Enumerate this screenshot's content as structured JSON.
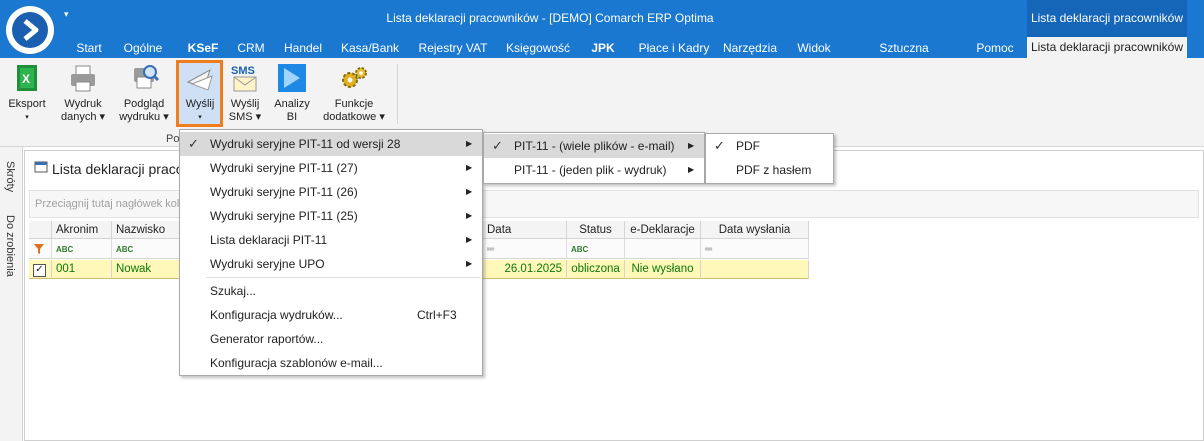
{
  "window": {
    "title": "Lista deklaracji pracowników - [DEMO] Comarch ERP Optima",
    "context_header": "Lista deklaracji pracowników",
    "qat_glyph": "▾"
  },
  "tabs": [
    {
      "label": "Start"
    },
    {
      "label": "Ogólne"
    },
    {
      "label": "KSeF"
    },
    {
      "label": "CRM"
    },
    {
      "label": "Handel"
    },
    {
      "label": "Kasa/Bank"
    },
    {
      "label": "Rejestry VAT"
    },
    {
      "label": "Księgowość"
    },
    {
      "label": "JPK"
    },
    {
      "label": "Płace i Kadry"
    },
    {
      "label": "Narzędzia"
    },
    {
      "label": "Widok"
    },
    {
      "label": "Sztuczna inteligencja"
    },
    {
      "label": "Pomoc"
    },
    {
      "label": "Lista deklaracji pracowników"
    }
  ],
  "ribbon": {
    "buttons": [
      {
        "line1": "Eksport",
        "line2": "▾",
        "icon": "excel-icon"
      },
      {
        "line1": "Wydruk",
        "line2": "danych ▾",
        "icon": "printer-icon"
      },
      {
        "line1": "Podgląd",
        "line2": "wydruku ▾",
        "icon": "print-preview-icon"
      },
      {
        "line1": "Wyślij",
        "line2": "▾",
        "icon": "send-icon"
      },
      {
        "line1": "Wyślij",
        "line2": "SMS ▾",
        "icon": "sms-icon"
      },
      {
        "line1": "Analizy",
        "line2": "BI",
        "icon": "bi-icon"
      },
      {
        "line1": "Funkcje",
        "line2": "dodatkowe ▾",
        "icon": "gears-icon"
      }
    ],
    "group_label": "Po"
  },
  "side_panel": {
    "shortcuts": "Skróty",
    "todo": "Do zrobienia"
  },
  "list": {
    "title": "Lista deklaracji praco",
    "group_placeholder": "Przeciągnij tutaj nagłówek kolu",
    "columns": [
      "Akronim ▲",
      "Nazwisko",
      "Data obliczenia",
      "Status",
      "e-Deklaracje",
      "Data wysłania"
    ],
    "filter_abc": "ABC",
    "filter_eq": "═",
    "rows": [
      {
        "checked": "✓",
        "akronim": "001",
        "nazwisko": "Nowak",
        "data_obliczenia": "26.01.2025",
        "status": "obliczona",
        "e_deklaracje": "Nie wysłano",
        "data_wyslania": ""
      }
    ]
  },
  "menu": {
    "items": [
      {
        "label": "Wydruki seryjne PIT-11 od wersji 28",
        "check": "✓",
        "arrow": "▶"
      },
      {
        "label": "Wydruki seryjne PIT-11 (27)",
        "arrow": "▶"
      },
      {
        "label": "Wydruki seryjne PIT-11 (26)",
        "arrow": "▶"
      },
      {
        "label": "Wydruki seryjne PIT-11 (25)",
        "arrow": "▶"
      },
      {
        "label": "Lista deklaracji PIT-11",
        "arrow": "▶"
      },
      {
        "label": "Wydruki seryjne UPO",
        "arrow": "▶"
      },
      {
        "label": "Szukaj..."
      },
      {
        "label": "Konfiguracja wydruków...",
        "shortcut": "Ctrl+F3"
      },
      {
        "label": "Generator raportów..."
      },
      {
        "label": "Konfiguracja szablonów e-mail..."
      }
    ]
  },
  "submenu1": {
    "items": [
      {
        "label": "PIT-11 - (wiele plików - e-mail)",
        "check": "✓",
        "arrow": "▶"
      },
      {
        "label": "PIT-11 - (jeden plik - wydruk)",
        "arrow": "▶"
      }
    ]
  },
  "submenu2": {
    "items": [
      {
        "label": "PDF",
        "check": "✓"
      },
      {
        "label": "PDF z hasłem"
      }
    ]
  },
  "colors": {
    "accent": "#1b78d0",
    "highlight_border": "#f07d1d",
    "row_highlight": "#fff8b8"
  }
}
